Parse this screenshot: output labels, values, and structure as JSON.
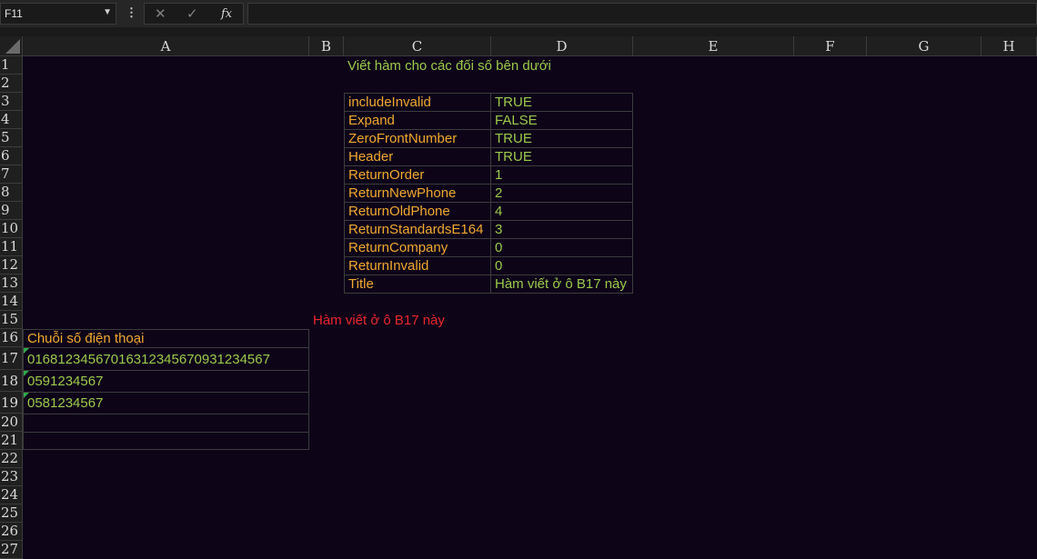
{
  "formula_bar": {
    "name_box": "F11",
    "fx_label": "fx",
    "formula": ""
  },
  "columns": [
    "A",
    "B",
    "C",
    "D",
    "E",
    "F",
    "G",
    "H"
  ],
  "rows": [
    "1",
    "2",
    "3",
    "4",
    "5",
    "6",
    "7",
    "8",
    "9",
    "10",
    "11",
    "12",
    "13",
    "14",
    "15",
    "16",
    "17",
    "18",
    "19",
    "20",
    "21",
    "22",
    "23",
    "24",
    "25",
    "26",
    "27"
  ],
  "heading": "Viết hàm cho các đối số bên dưới",
  "params": [
    {
      "name": "includeInvalid",
      "value": "TRUE"
    },
    {
      "name": "Expand",
      "value": "FALSE"
    },
    {
      "name": "ZeroFrontNumber",
      "value": "TRUE"
    },
    {
      "name": "Header",
      "value": "TRUE"
    },
    {
      "name": "ReturnOrder",
      "value": "1"
    },
    {
      "name": "ReturnNewPhone",
      "value": "2"
    },
    {
      "name": "ReturnOldPhone",
      "value": "4"
    },
    {
      "name": "ReturnStandardsE164",
      "value": "3"
    },
    {
      "name": "ReturnCompany",
      "value": "0"
    },
    {
      "name": "ReturnInvalid",
      "value": "0"
    },
    {
      "name": "Title",
      "value": "Hàm viết ở ô B17 này"
    }
  ],
  "note": "Hàm viết ở ô B17 này",
  "phone_table": {
    "header": "Chuỗi số điện thoại",
    "values": [
      "01681234567016312345670931234567",
      "0591234567",
      "0581234567",
      "",
      ""
    ]
  },
  "colors": {
    "background": "#0d0418",
    "label": "#f0a830",
    "value": "#9cc94a",
    "note": "#e8262e"
  }
}
